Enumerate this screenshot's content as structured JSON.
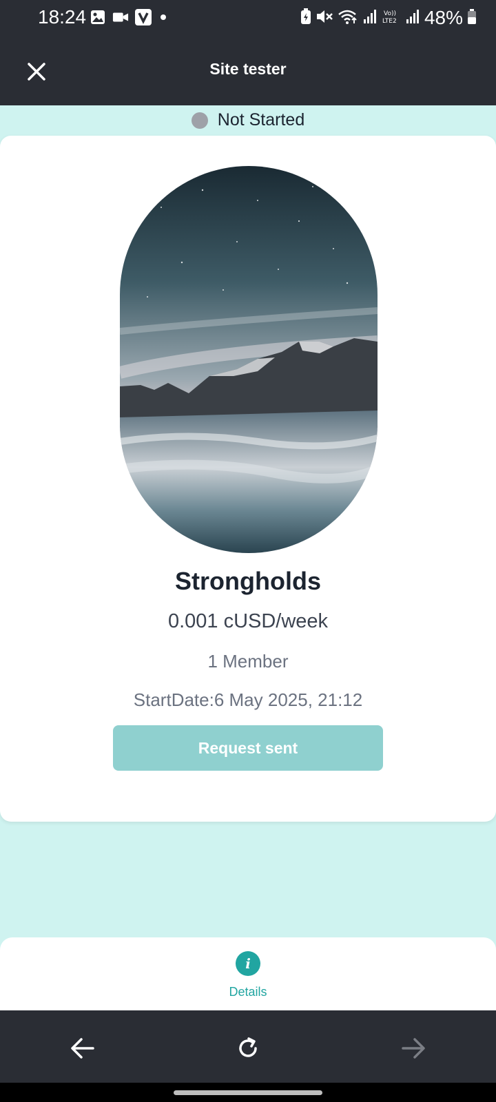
{
  "status_bar": {
    "time": "18:24",
    "battery": "48%",
    "icons_left": [
      "gallery-icon",
      "video-icon",
      "v-app-icon",
      "dot-icon"
    ],
    "icons_right": [
      "battery-saver-icon",
      "mute-icon",
      "wifi-icon",
      "signal-icon",
      "volte-icon",
      "signal-icon-2",
      "battery-icon"
    ]
  },
  "app_bar": {
    "title": "Site tester",
    "close_icon": "close-icon"
  },
  "group_status": {
    "label": "Not Started",
    "dot_color": "#9ea1a8"
  },
  "card": {
    "image_description_icon": "landscape-image",
    "name": "Strongholds",
    "price": "0.001 cUSD/week",
    "members": "1 Member",
    "start_date": "StartDate:6 May 2025, 21:12",
    "request_button": "Request sent"
  },
  "bottom_tab": {
    "details_label": "Details",
    "details_icon": "info-icon",
    "accent": "#21a5a1"
  },
  "browser_nav": {
    "back_icon": "arrow-left-icon",
    "reload_icon": "reload-icon",
    "forward_icon": "arrow-right-icon"
  },
  "colors": {
    "dark_bar": "#2a2d34",
    "background": "#cff3f0",
    "button": "#8fd0cf"
  }
}
